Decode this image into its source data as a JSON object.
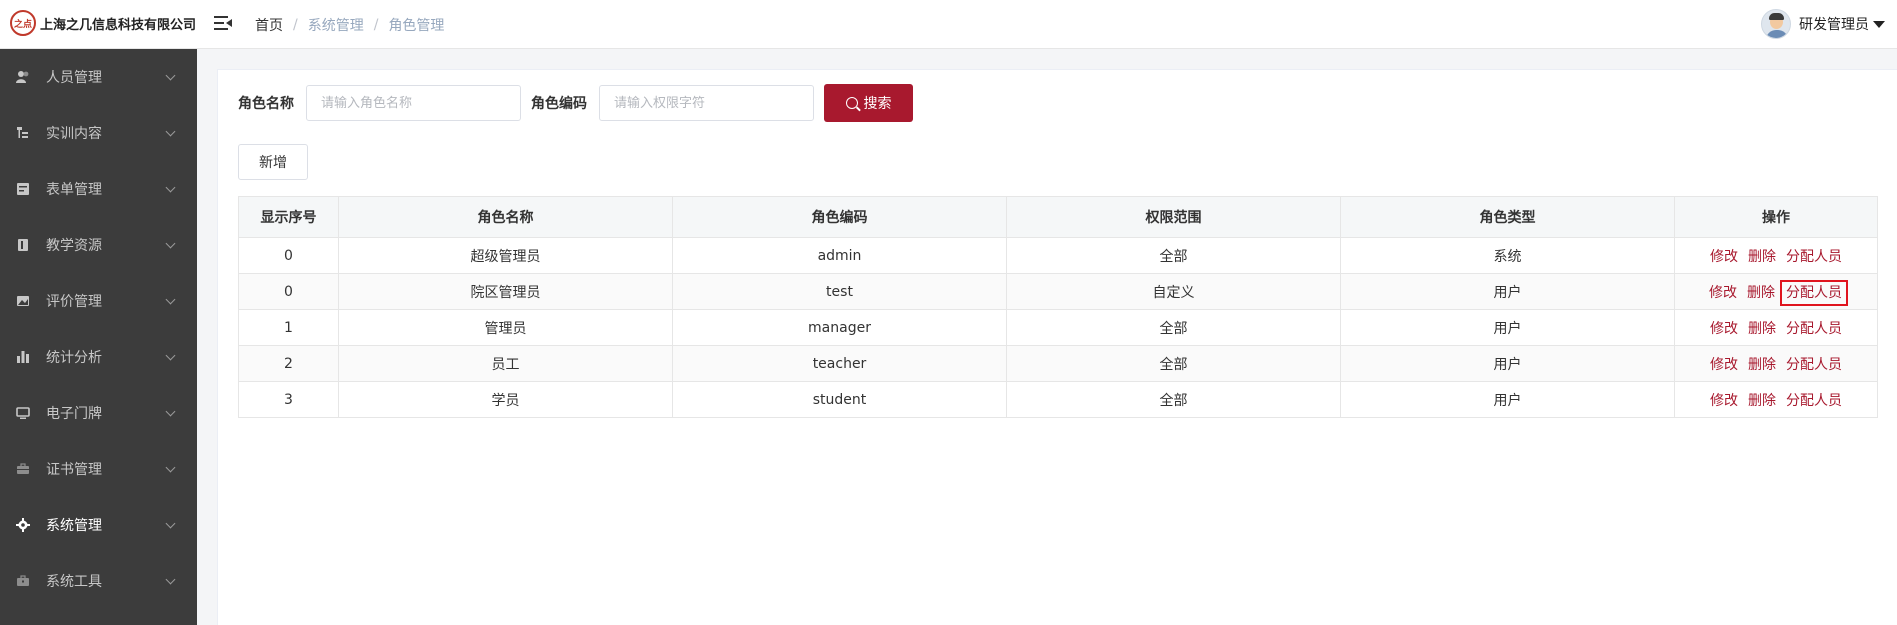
{
  "brand": {
    "logo_text": "之点",
    "name": "上海之几信息科技有限公司"
  },
  "breadcrumb": [
    "首页",
    "系统管理",
    "角色管理"
  ],
  "user": {
    "name": "研发管理员"
  },
  "sidebar": {
    "items": [
      {
        "label": "人员管理",
        "icon": "users-icon",
        "active": false
      },
      {
        "label": "实训内容",
        "icon": "tree-icon",
        "active": false
      },
      {
        "label": "表单管理",
        "icon": "form-icon",
        "active": false
      },
      {
        "label": "教学资源",
        "icon": "book-icon",
        "active": false
      },
      {
        "label": "评价管理",
        "icon": "picture-icon",
        "active": false
      },
      {
        "label": "统计分析",
        "icon": "bar-chart-icon",
        "active": false
      },
      {
        "label": "电子门牌",
        "icon": "monitor-icon",
        "active": false
      },
      {
        "label": "证书管理",
        "icon": "briefcase-icon",
        "active": false
      },
      {
        "label": "系统管理",
        "icon": "gear-icon",
        "active": true
      },
      {
        "label": "系统工具",
        "icon": "toolbox-icon",
        "active": false
      }
    ]
  },
  "search": {
    "role_name_label": "角色名称",
    "role_name_placeholder": "请输入角色名称",
    "role_name_value": "",
    "role_code_label": "角色编码",
    "role_code_placeholder": "请输入权限字符",
    "role_code_value": "",
    "search_button": "搜索"
  },
  "toolbar": {
    "new_button": "新增"
  },
  "table": {
    "headers": [
      "显示序号",
      "角色名称",
      "角色编码",
      "权限范围",
      "角色类型",
      "操作"
    ],
    "rows": [
      {
        "order": "0",
        "name": "超级管理员",
        "code": "admin",
        "scope": "全部",
        "type": "系统"
      },
      {
        "order": "0",
        "name": "院区管理员",
        "code": "test",
        "scope": "自定义",
        "type": "用户"
      },
      {
        "order": "1",
        "name": "管理员",
        "code": "manager",
        "scope": "全部",
        "type": "用户"
      },
      {
        "order": "2",
        "name": "员工",
        "code": "teacher",
        "scope": "全部",
        "type": "用户"
      },
      {
        "order": "3",
        "name": "学员",
        "code": "student",
        "scope": "全部",
        "type": "用户"
      }
    ],
    "actions": {
      "edit": "修改",
      "delete": "删除",
      "assign": "分配人员"
    }
  },
  "colors": {
    "accent": "#a8192e",
    "sidebar_bg": "#3c3c3c",
    "highlight_box": "#e0141e"
  }
}
